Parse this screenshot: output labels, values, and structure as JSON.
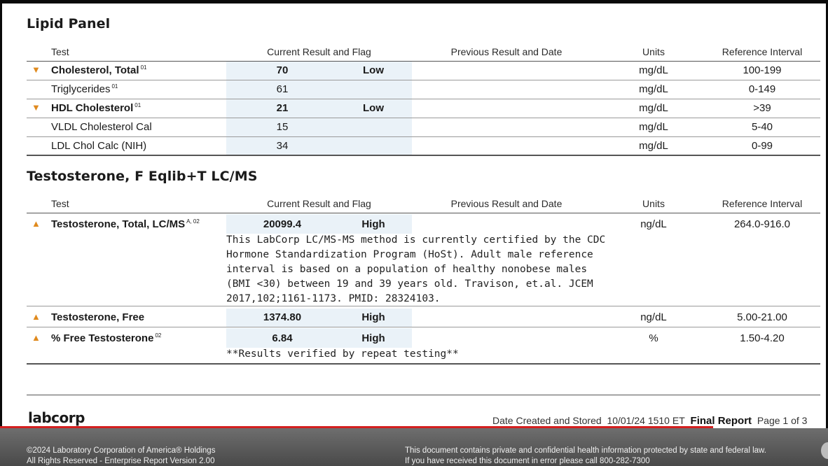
{
  "lipid": {
    "title": "Lipid Panel",
    "headers": {
      "test": "Test",
      "current": "Current Result and Flag",
      "previous": "Previous Result and Date",
      "units": "Units",
      "reference": "Reference Interval"
    },
    "rows": [
      {
        "name": "Cholesterol, Total",
        "sup": "01",
        "value": "70",
        "flag": "Low",
        "units": "mg/dL",
        "ref": "100-199"
      },
      {
        "name": "Triglycerides",
        "sup": "01",
        "value": "61",
        "flag": "",
        "units": "mg/dL",
        "ref": "0-149"
      },
      {
        "name": "HDL Cholesterol",
        "sup": "01",
        "value": "21",
        "flag": "Low",
        "units": "mg/dL",
        "ref": ">39"
      },
      {
        "name": "VLDL Cholesterol Cal",
        "sup": "",
        "value": "15",
        "flag": "",
        "units": "mg/dL",
        "ref": "5-40"
      },
      {
        "name": "LDL Chol Calc (NIH)",
        "sup": "",
        "value": "34",
        "flag": "",
        "units": "mg/dL",
        "ref": "0-99"
      }
    ]
  },
  "testo": {
    "title": "Testosterone, F Eqlib+T LC/MS",
    "headers": {
      "test": "Test",
      "current": "Current Result and Flag",
      "previous": "Previous Result and Date",
      "units": "Units",
      "reference": "Reference Interval"
    },
    "rows": [
      {
        "name": "Testosterone, Total, LC/MS",
        "sup": "A, 02",
        "value": "20099.4",
        "flag": "High",
        "units": "ng/dL",
        "ref": "264.0-916.0",
        "note": "This LabCorp LC/MS-MS method is currently certified by the CDC\nHormone Standardization Program (HoSt). Adult male reference\ninterval is based on a population of healthy nonobese males\n(BMI <30) between 19 and 39 years old. Travison, et.al. JCEM\n2017,102;1161-1173. PMID: 28324103."
      },
      {
        "name": "Testosterone, Free",
        "sup": "",
        "value": "1374.80",
        "flag": "High",
        "units": "ng/dL",
        "ref": "5.00-21.00",
        "note": ""
      },
      {
        "name": "% Free Testosterone",
        "sup": "02",
        "value": "6.84",
        "flag": "High",
        "units": "%",
        "ref": "1.50-4.20",
        "note": "**Results verified by repeat testing**"
      }
    ]
  },
  "footer": {
    "logo": "labcorp",
    "date_label": "Date Created and Stored",
    "date_value": "10/01/24 1510 ET",
    "final": "Final Report",
    "page": "Page 1 of 3",
    "copyright_1": "©2024 Laboratory Corporation of America® Holdings",
    "copyright_2": "All Rights Reserved - Enterprise Report Version 2.00",
    "privacy_1": "This document contains private and confidential health information protected by state and federal law.",
    "privacy_2": "If you have received this document in error please call 800-282-7300"
  },
  "icons": {
    "low_flag": "triangle-down-icon",
    "high_flag": "triangle-up-icon"
  },
  "colors": {
    "flag": "#e08a1e",
    "shade": "#eaf2f8",
    "redbar": "#d41f1f"
  }
}
